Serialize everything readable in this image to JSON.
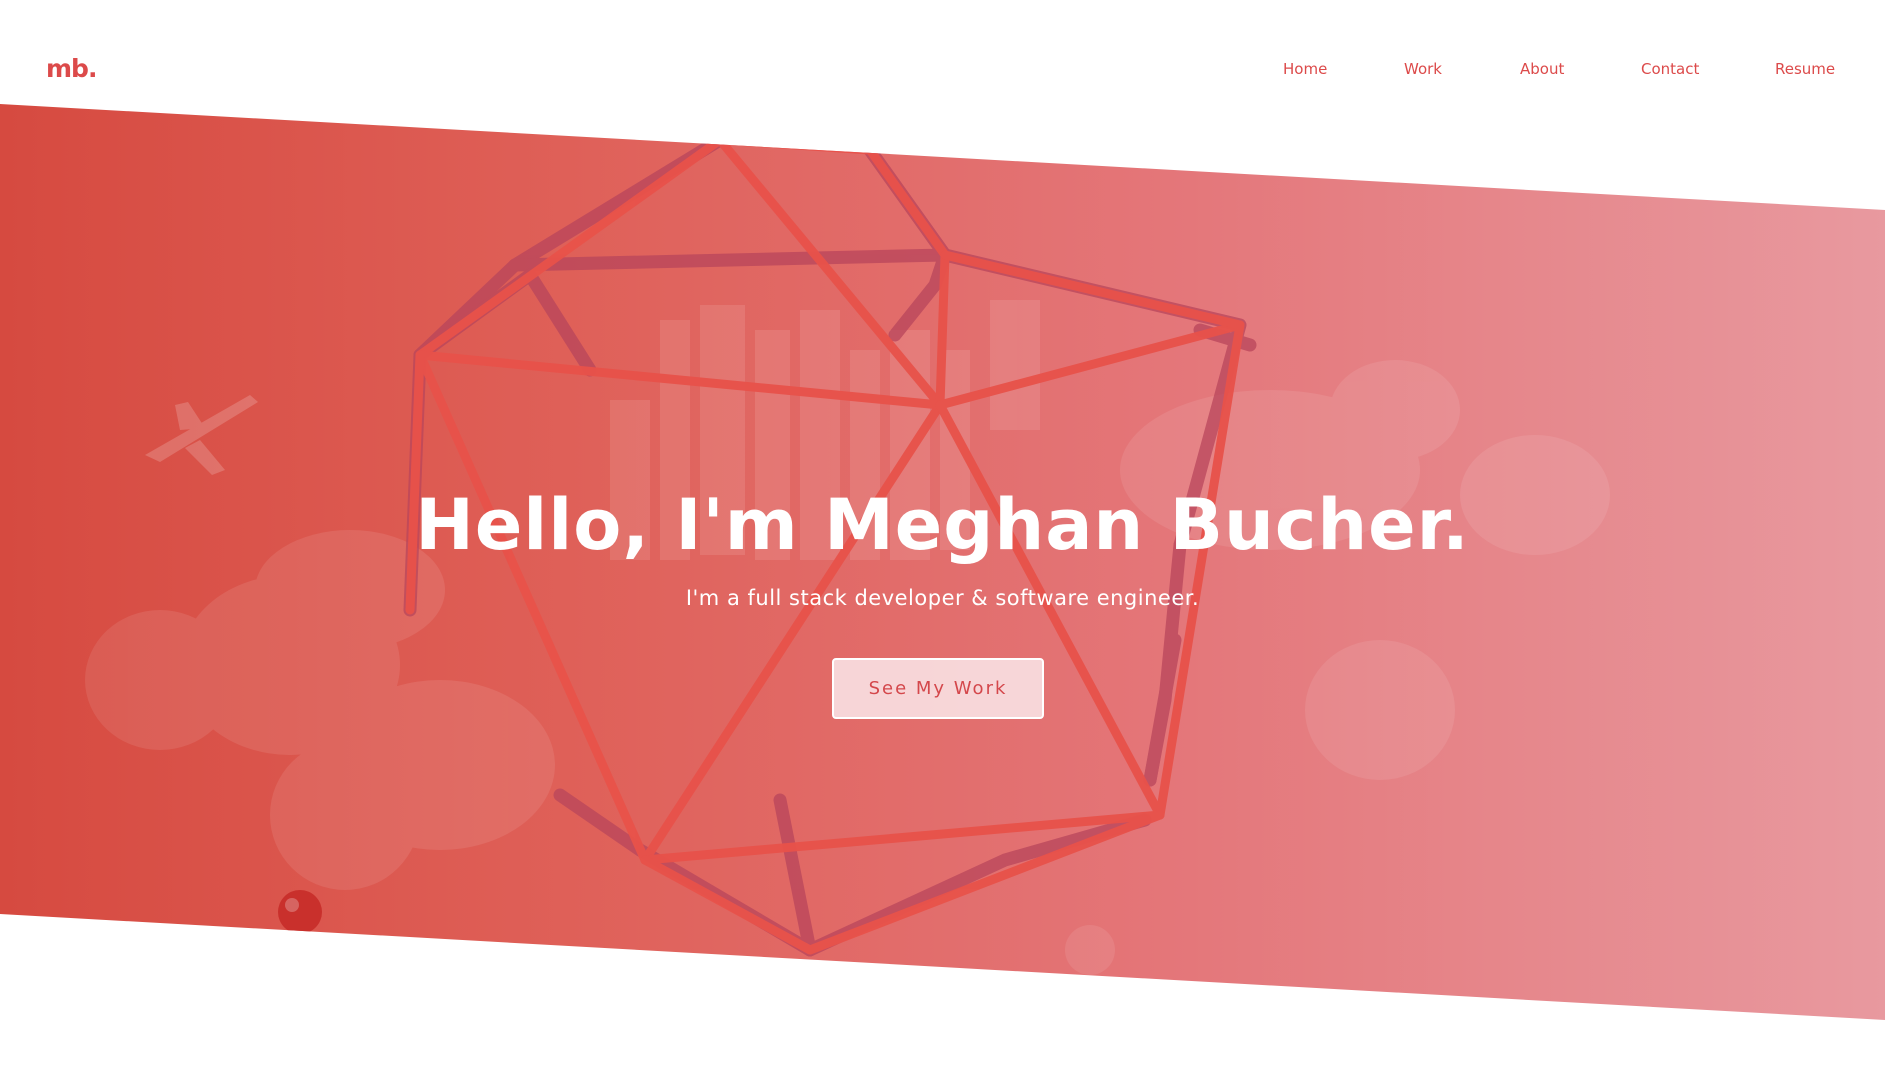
{
  "header": {
    "logo": "mb.",
    "nav": [
      {
        "label": "Home"
      },
      {
        "label": "Work"
      },
      {
        "label": "About"
      },
      {
        "label": "Contact"
      },
      {
        "label": "Resume"
      }
    ]
  },
  "hero": {
    "title": "Hello, I'm Meghan Bucher.",
    "subtitle": "I'm a full stack developer & software engineer.",
    "cta_label": "See My Work"
  },
  "colors": {
    "accent": "#dc4a4a",
    "gradient_start": "#d64a40",
    "gradient_end": "#e8999f",
    "button_bg": "#f8dee1"
  }
}
